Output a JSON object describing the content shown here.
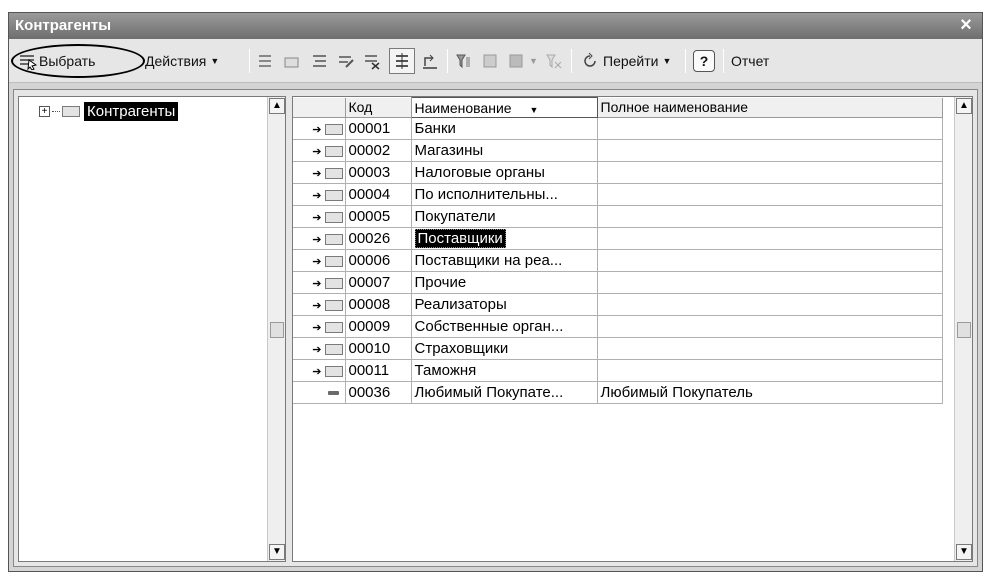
{
  "window": {
    "title": "Контрагенты",
    "close_glyph": "×"
  },
  "toolbar": {
    "select_label": "Выбрать",
    "actions_label": "Действия",
    "goto_label": "Перейти",
    "help_label": "?",
    "report_label": "Отчет"
  },
  "tree": {
    "root_label": "Контрагенты",
    "expander": "⊞"
  },
  "grid": {
    "columns": [
      "Код",
      "Наименование",
      "Полное наименование"
    ],
    "sort_indicator": "▼",
    "rows": [
      {
        "type": "group",
        "code": "00001",
        "name": "Банки",
        "full_name": ""
      },
      {
        "type": "group",
        "code": "00002",
        "name": "Магазины",
        "full_name": ""
      },
      {
        "type": "group",
        "code": "00003",
        "name": "Налоговые органы",
        "full_name": ""
      },
      {
        "type": "group",
        "code": "00004",
        "name": "По исполнительны...",
        "full_name": ""
      },
      {
        "type": "group",
        "code": "00005",
        "name": "Покупатели",
        "full_name": ""
      },
      {
        "type": "group",
        "code": "00026",
        "name": "Поставщики",
        "full_name": "",
        "selected": true
      },
      {
        "type": "group",
        "code": "00006",
        "name": "Поставщики на реа...",
        "full_name": ""
      },
      {
        "type": "group",
        "code": "00007",
        "name": "Прочие",
        "full_name": ""
      },
      {
        "type": "group",
        "code": "00008",
        "name": "Реализаторы",
        "full_name": ""
      },
      {
        "type": "group",
        "code": "00009",
        "name": "Собственные орган...",
        "full_name": ""
      },
      {
        "type": "group",
        "code": "00010",
        "name": "Страховщики",
        "full_name": ""
      },
      {
        "type": "group",
        "code": "00011",
        "name": "Таможня",
        "full_name": ""
      },
      {
        "type": "item",
        "code": "00036",
        "name": "Любимый Покупате...",
        "full_name": "Любимый Покупатель"
      }
    ]
  },
  "colors": {
    "titlebar": "#7a7a7a",
    "selection": "#000000",
    "background": "#d4d4d4"
  }
}
